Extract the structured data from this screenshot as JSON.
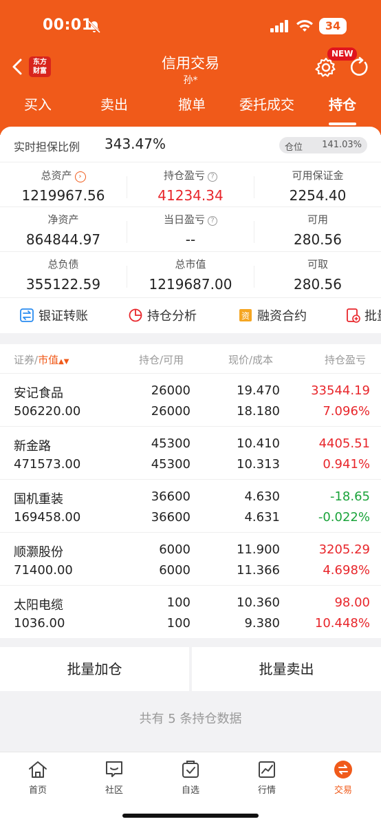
{
  "status_bar": {
    "time": "00:01",
    "battery": "34"
  },
  "header": {
    "logo_text": "东方\n财富",
    "title": "信用交易",
    "subtitle": "孙*",
    "new_badge": "NEW",
    "tabs": [
      "买入",
      "卖出",
      "撤单",
      "委托成交",
      "持仓"
    ],
    "active_tab": "持仓"
  },
  "summary": {
    "ratio_label": "实时担保比例",
    "ratio_value": "343.47%",
    "position_label": "仓位",
    "position_value": "141.03%",
    "metrics": [
      {
        "label": "总资产",
        "value": "1219967.56"
      },
      {
        "label": "持仓盈亏",
        "value": "41234.34"
      },
      {
        "label": "可用保证金",
        "value": "2254.40"
      },
      {
        "label": "净资产",
        "value": "864844.97"
      },
      {
        "label": "当日盈亏",
        "value": "--"
      },
      {
        "label": "可用",
        "value": "280.56"
      },
      {
        "label": "总负债",
        "value": "355122.59"
      },
      {
        "label": "总市值",
        "value": "1219687.00"
      },
      {
        "label": "可取",
        "value": "280.56"
      }
    ]
  },
  "tools": [
    "银证转账",
    "持仓分析",
    "融资合约",
    "批量"
  ],
  "list_header": {
    "col1a": "证券",
    "col1b": "市值",
    "col2": "持仓/可用",
    "col3": "现价/成本",
    "col4": "持仓盈亏"
  },
  "holdings": [
    {
      "name": "安记食品",
      "market_value": "506220.00",
      "qty": "26000",
      "avail": "26000",
      "price": "19.470",
      "cost": "18.180",
      "pnl": "33544.19",
      "pct": "7.096%"
    },
    {
      "name": "新金路",
      "market_value": "471573.00",
      "qty": "45300",
      "avail": "45300",
      "price": "10.410",
      "cost": "10.313",
      "pnl": "4405.51",
      "pct": "0.941%"
    },
    {
      "name": "国机重装",
      "market_value": "169458.00",
      "qty": "36600",
      "avail": "36600",
      "price": "4.630",
      "cost": "4.631",
      "pnl": "-18.65",
      "pct": "-0.022%"
    },
    {
      "name": "顺灏股份",
      "market_value": "71400.00",
      "qty": "6000",
      "avail": "6000",
      "price": "11.900",
      "cost": "11.366",
      "pnl": "3205.29",
      "pct": "4.698%"
    },
    {
      "name": "太阳电缆",
      "market_value": "1036.00",
      "qty": "100",
      "avail": "100",
      "price": "10.360",
      "cost": "9.380",
      "pnl": "98.00",
      "pct": "10.448%"
    }
  ],
  "batch": {
    "add": "批量加仓",
    "sell": "批量卖出"
  },
  "summary_text": "共有 5 条持仓数据",
  "bottom_nav": [
    {
      "label": "首页",
      "icon": "home-icon"
    },
    {
      "label": "社区",
      "icon": "chat-icon"
    },
    {
      "label": "自选",
      "icon": "watchlist-icon"
    },
    {
      "label": "行情",
      "icon": "chart-icon"
    },
    {
      "label": "交易",
      "icon": "trade-icon"
    }
  ],
  "colors": {
    "brand": "#f05a1a",
    "up": "#e8262b",
    "down": "#1aa33a"
  }
}
